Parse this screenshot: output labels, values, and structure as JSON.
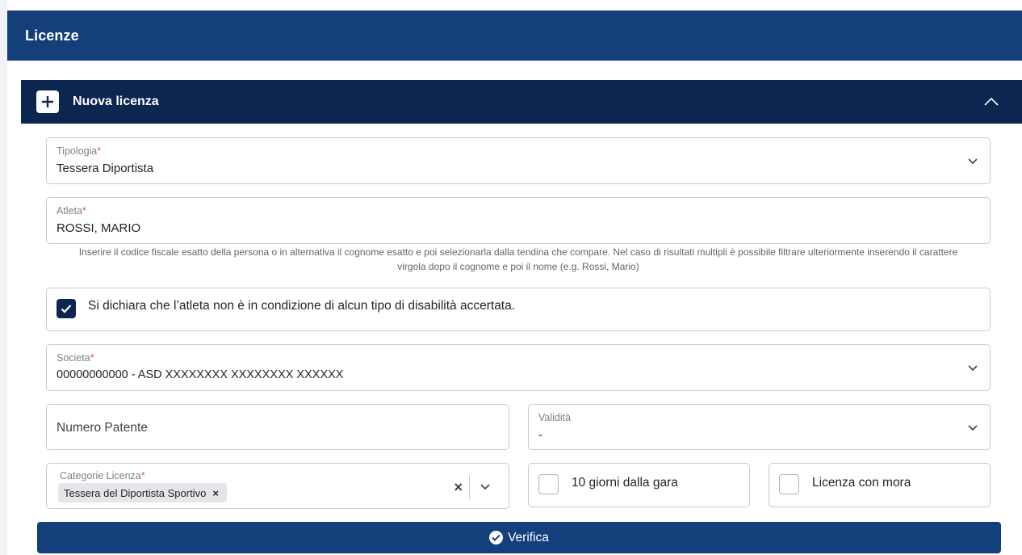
{
  "header": {
    "title": "Licenze"
  },
  "panel": {
    "title": "Nuova licenza"
  },
  "form": {
    "tipologia": {
      "label": "Tipologia",
      "required_mark": "*",
      "value": "Tessera Diportista"
    },
    "atleta": {
      "label": "Atleta",
      "required_mark": "*",
      "value": "ROSSI, MARIO",
      "hint_line1": "Inserire il codice fiscale esatto della persona o in alternativa il cognome esatto e poi selezionarla dalla tendina che compare. Nel caso di risultati multipli è possibile filtrare ulteriormente inserendo il carattere",
      "hint_line2": "virgola dopo il cognome e poi il nome (e.g. Rossi, Mario)"
    },
    "declaration": {
      "text": "Si dichiara che l’atleta non è in condizione di alcun tipo di disabilità accertata.",
      "checked": true
    },
    "societa": {
      "label": "Societa",
      "required_mark": "*",
      "value": "00000000000 - ASD XXXXXXXX XXXXXXXX XXXXXX"
    },
    "numero_patente": {
      "placeholder": "Numero Patente"
    },
    "validita": {
      "label": "Validità",
      "value": "-"
    },
    "categorie": {
      "label": "Categorie Licenza",
      "required_mark": "*",
      "chip": "Tessera del Diportista Sportivo",
      "chip_remove": "×",
      "clear": "×"
    },
    "dieci_giorni": {
      "label": "10 giorni dalla gara",
      "checked": false
    },
    "mora": {
      "label": "Licenza con mora",
      "checked": false
    }
  },
  "actions": {
    "verify_label": "Verifica"
  },
  "colors": {
    "primary": "#143f7b",
    "panel_dark": "#0d2650",
    "required": "#d9534f",
    "border": "#c7ccd2"
  },
  "icons": {
    "add": "plus-icon",
    "collapse": "chevron-up-icon",
    "dropdown": "chevron-down-icon",
    "check": "check-icon",
    "verify": "check-circle-icon"
  }
}
